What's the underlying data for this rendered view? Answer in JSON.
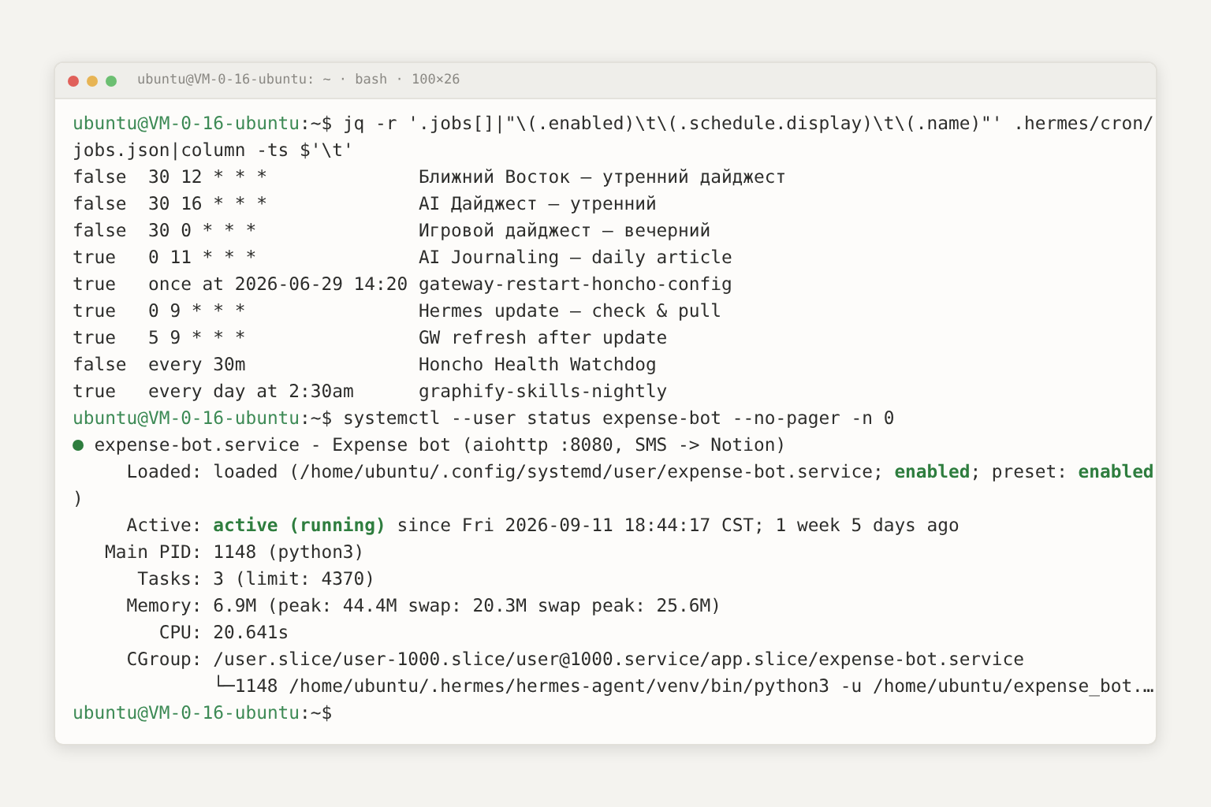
{
  "window": {
    "title": "ubuntu@VM-0-16-ubuntu: ~ · bash · 100×26"
  },
  "lines": [
    {
      "kind": "prompt",
      "user": "ubuntu@VM-0-16-ubuntu",
      "path": ":~$",
      "command": "jq -r '.jobs[]|\"\\(.enabled)\\t\\(.schedule.display)\\t\\(.name)\"' .hermes/cron/"
    },
    {
      "kind": "plain",
      "text": "jobs.json|column -ts $'\\t'"
    },
    {
      "kind": "job",
      "enabled": "false",
      "schedule": "30 12 * * *",
      "name": "Ближний Восток — утренний дайджест"
    },
    {
      "kind": "job",
      "enabled": "false",
      "schedule": "30 16 * * *",
      "name": "AI Дайджест — утренний"
    },
    {
      "kind": "job",
      "enabled": "false",
      "schedule": "30 0 * * *",
      "name": "Игровой дайджест — вечерний"
    },
    {
      "kind": "job",
      "enabled": "true",
      "schedule": "0 11 * * *",
      "name": "AI Journaling — daily article"
    },
    {
      "kind": "job",
      "enabled": "true",
      "schedule": "once at 2026-06-29 14:20",
      "name": "gateway-restart-honcho-config"
    },
    {
      "kind": "job",
      "enabled": "true",
      "schedule": "0 9 * * *",
      "name": "Hermes update — check & pull"
    },
    {
      "kind": "job",
      "enabled": "true",
      "schedule": "5 9 * * *",
      "name": "GW refresh after update"
    },
    {
      "kind": "job",
      "enabled": "false",
      "schedule": "every 30m",
      "name": "Honcho Health Watchdog"
    },
    {
      "kind": "job",
      "enabled": "true",
      "schedule": "every day at 2:30am",
      "name": "graphify-skills-nightly"
    },
    {
      "kind": "prompt",
      "user": "ubuntu@VM-0-16-ubuntu",
      "path": ":~$",
      "command": "systemctl --user status expense-bot --no-pager -n 0"
    },
    {
      "kind": "unit",
      "color": "#2e7d3e",
      "text": "expense-bot.service - Expense bot (aiohttp :8080, SMS -> Notion)"
    },
    {
      "kind": "field",
      "label": "Loaded:",
      "value": "loaded (/home/ubuntu/.config/systemd/user/expense-bot.service; **enabled**; preset: **enabled**"
    },
    {
      "kind": "plain",
      "text": ")"
    },
    {
      "kind": "field",
      "label": "Active:",
      "value": "**active (running)** since Fri 2026-09-11 18:44:17 CST; 1 week 5 days ago"
    },
    {
      "kind": "field",
      "label": "Main PID:",
      "value": "1148 (python3)"
    },
    {
      "kind": "field",
      "label": "Tasks:",
      "value": "3 (limit: 4370)"
    },
    {
      "kind": "field",
      "label": "Memory:",
      "value": "6.9M (peak: 44.4M swap: 20.3M swap peak: 25.6M)"
    },
    {
      "kind": "field",
      "label": "CPU:",
      "value": "20.641s"
    },
    {
      "kind": "field",
      "label": "CGroup:",
      "value": "/user.slice/user-1000.slice/user@1000.service/app.slice/expense-bot.service"
    },
    {
      "kind": "tree",
      "text": "└─1148 /home/ubuntu/.hermes/hermes-agent/venv/bin/python3 -u /home/ubuntu/expense_bot.…"
    },
    {
      "kind": "prompt",
      "user": "ubuntu@VM-0-16-ubuntu",
      "path": ":~$"
    }
  ]
}
